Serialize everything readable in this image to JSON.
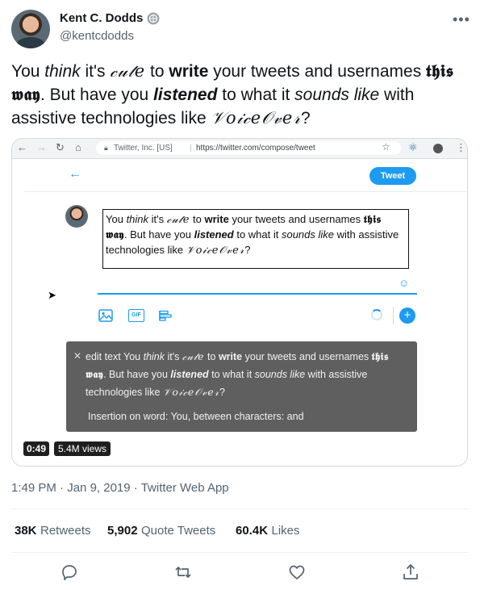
{
  "author": {
    "name": "Kent C. Dodds",
    "handle": "@kentcdodds"
  },
  "more_glyph": "•••",
  "tweet": {
    "p1": "You ",
    "think": "think",
    "p2": " it's ",
    "cute": "𝒸𝓊𝓉𝑒",
    "p3": " to ",
    "write": "write",
    "p4": " your tweets and usernames ",
    "this_way": "𝖙𝖍𝖎𝖘 𝖜𝖆𝖞",
    "p5": ". But have you ",
    "listened": "listened",
    "p6": " to what it ",
    "sounds_like": "sounds like",
    "p7": " with assistive technologies like ",
    "voiceover": "𝒱𝑜𝒾𝒸𝑒𝒪𝓋𝑒𝓇",
    "p8": "?"
  },
  "video": {
    "browser": {
      "site": "Twitter, Inc. [US]",
      "separator": "|",
      "url": "https://twitter.com/compose/tweet"
    },
    "tweet_button": "Tweet",
    "gif_label": "GIF",
    "voiceover": {
      "prefix": "edit text You ",
      "think": "think",
      "p2": " it's ",
      "cute": "𝒸𝓊𝓉𝑒",
      "p3": " to ",
      "write": "write",
      "p4": " your tweets and usernames ",
      "this_way": "𝖙𝖍𝖎𝖘 𝖜𝖆𝖞",
      "p5": ". But have you ",
      "listened": "listened",
      "p6": " to what it ",
      "sounds_like": "sounds like",
      "p7": " with assistive technologies like ",
      "voiceover": "𝒱𝑜𝒾𝒸𝑒𝒪𝓋𝑒𝓇",
      "p8": "?",
      "insertion": "Insertion on word: You,   between  characters:   and"
    },
    "duration": "0:49",
    "views": "5.4M views"
  },
  "meta": {
    "time": "1:49 PM",
    "dot": " · ",
    "date": "Jan 9, 2019",
    "source": "Twitter Web App"
  },
  "stats": {
    "retweets_num": "38K",
    "retweets_label": "Retweets",
    "quotes_num": "5,902",
    "quotes_label": "Quote Tweets",
    "likes_num": "60.4K",
    "likes_label": "Likes"
  },
  "colors": {
    "accent": "#1d9bf0",
    "muted": "#536471",
    "text": "#0f1419"
  }
}
